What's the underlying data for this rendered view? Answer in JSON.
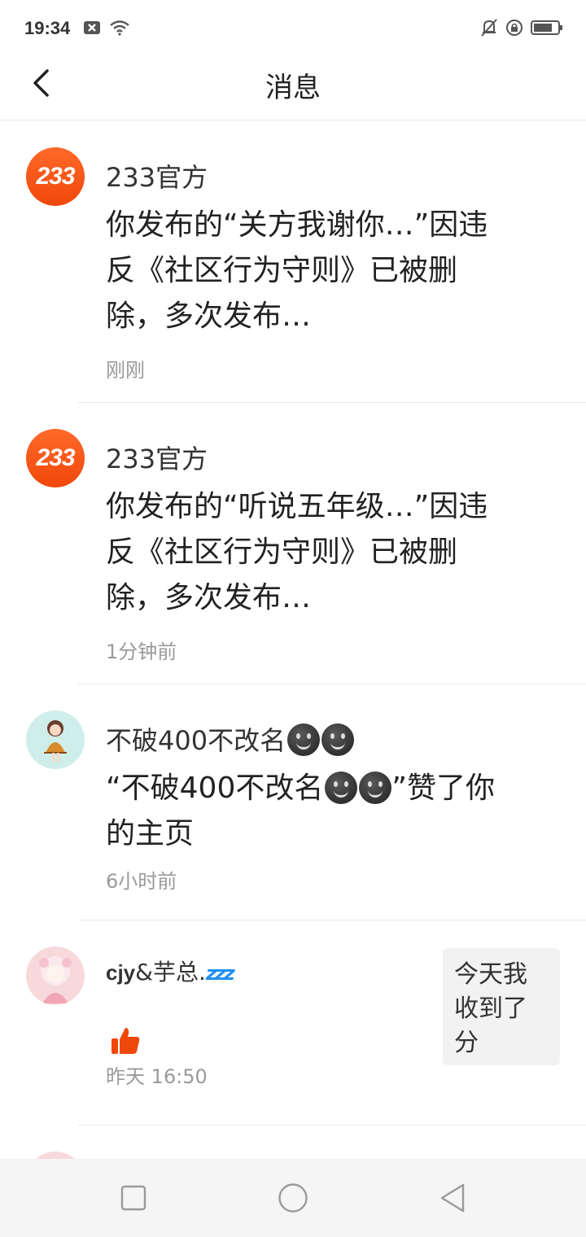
{
  "status_bar": {
    "time": "19:34"
  },
  "header": {
    "title": "消息"
  },
  "messages": [
    {
      "sender": "233官方",
      "body": "你发布的“关方我谢你…”因违反《社区行为守则》已被删除，多次发布…",
      "time": "刚刚"
    },
    {
      "sender": "233官方",
      "body": "你发布的“听说五年级…”因违反《社区行为守则》已被删除，多次发布…",
      "time": "1分钟前"
    },
    {
      "sender": "不破400不改名",
      "body_prefix": "“不破400不改名",
      "body_suffix": "”赞了你的主页",
      "time": "6小时前"
    },
    {
      "sender_prefix": "cjy",
      "sender_suffix": "&芋总.",
      "sender_sleep": "zzz",
      "time": "昨天 16:50",
      "preview": "今天我收到了分"
    }
  ],
  "avatar_233_text": "233",
  "colors": {
    "accent": "#f0470a",
    "sleep_blue": "#1f8ff0"
  }
}
